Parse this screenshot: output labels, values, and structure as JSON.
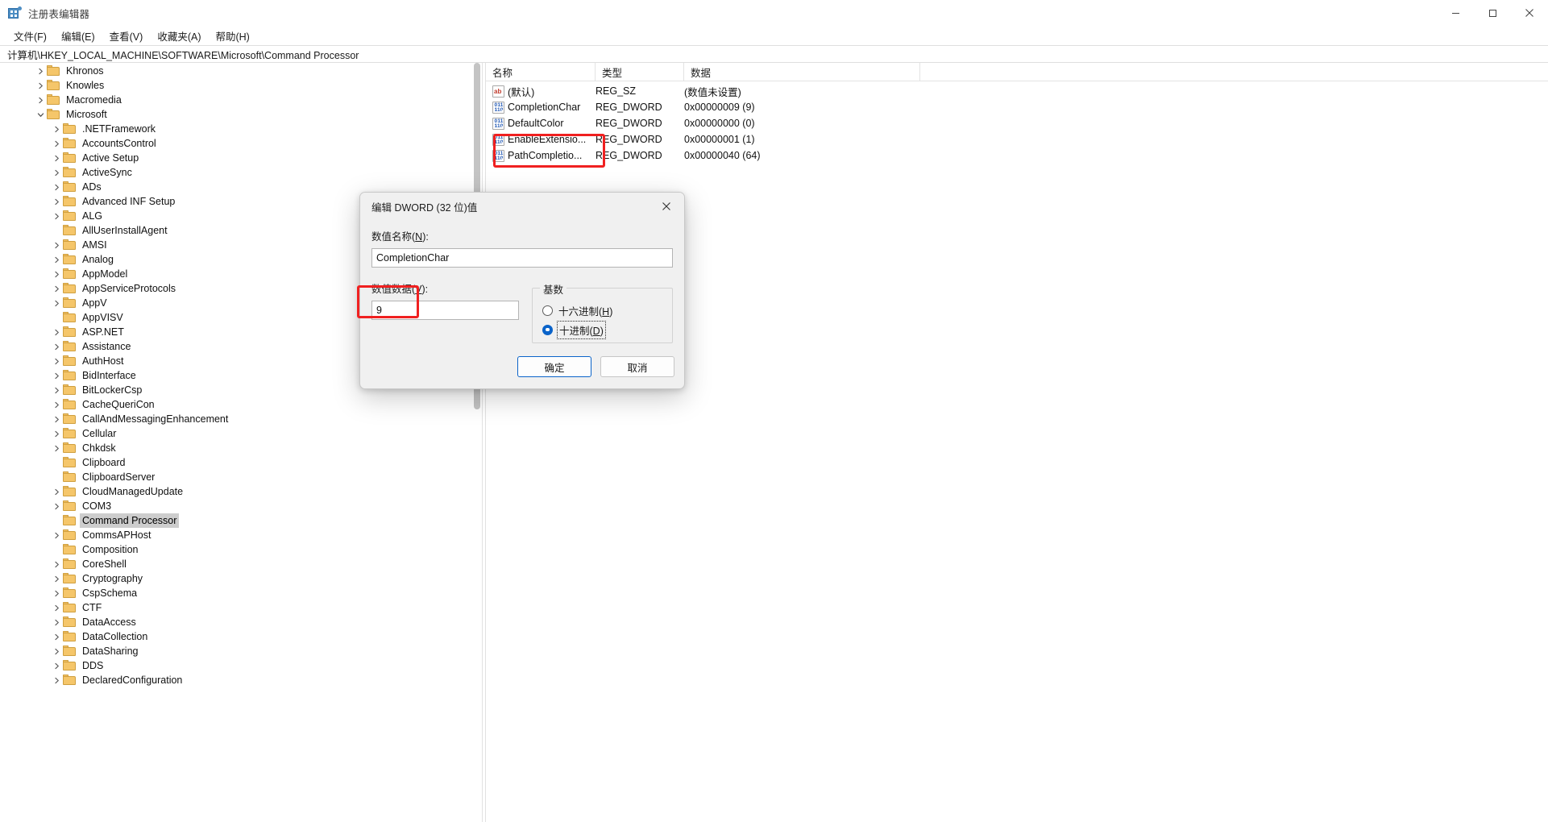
{
  "window": {
    "title": "注册表编辑器",
    "icon": "registry-editor-icon",
    "minimize_label": "最小化",
    "maximize_label": "最大化",
    "close_label": "关闭"
  },
  "menubar": {
    "items": [
      {
        "label": "文件(F)",
        "name": "menu-file"
      },
      {
        "label": "编辑(E)",
        "name": "menu-edit"
      },
      {
        "label": "查看(V)",
        "name": "menu-view"
      },
      {
        "label": "收藏夹(A)",
        "name": "menu-favorites"
      },
      {
        "label": "帮助(H)",
        "name": "menu-help"
      }
    ]
  },
  "address": {
    "path": "计算机\\HKEY_LOCAL_MACHINE\\SOFTWARE\\Microsoft\\Command Processor"
  },
  "tree": {
    "nodes": [
      {
        "label": "Khronos",
        "indent": 1,
        "expandable": true,
        "selected": false
      },
      {
        "label": "Knowles",
        "indent": 1,
        "expandable": true,
        "selected": false
      },
      {
        "label": "Macromedia",
        "indent": 1,
        "expandable": true,
        "selected": false
      },
      {
        "label": "Microsoft",
        "indent": 1,
        "expandable": true,
        "expanded": true,
        "selected": false
      },
      {
        "label": ".NETFramework",
        "indent": 2,
        "expandable": true,
        "selected": false
      },
      {
        "label": "AccountsControl",
        "indent": 2,
        "expandable": true,
        "selected": false
      },
      {
        "label": "Active Setup",
        "indent": 2,
        "expandable": true,
        "selected": false
      },
      {
        "label": "ActiveSync",
        "indent": 2,
        "expandable": true,
        "selected": false
      },
      {
        "label": "ADs",
        "indent": 2,
        "expandable": true,
        "selected": false
      },
      {
        "label": "Advanced INF Setup",
        "indent": 2,
        "expandable": true,
        "selected": false
      },
      {
        "label": "ALG",
        "indent": 2,
        "expandable": true,
        "selected": false
      },
      {
        "label": "AllUserInstallAgent",
        "indent": 2,
        "expandable": false,
        "selected": false
      },
      {
        "label": "AMSI",
        "indent": 2,
        "expandable": true,
        "selected": false
      },
      {
        "label": "Analog",
        "indent": 2,
        "expandable": true,
        "selected": false
      },
      {
        "label": "AppModel",
        "indent": 2,
        "expandable": true,
        "selected": false
      },
      {
        "label": "AppServiceProtocols",
        "indent": 2,
        "expandable": true,
        "selected": false
      },
      {
        "label": "AppV",
        "indent": 2,
        "expandable": true,
        "selected": false
      },
      {
        "label": "AppVISV",
        "indent": 2,
        "expandable": false,
        "selected": false
      },
      {
        "label": "ASP.NET",
        "indent": 2,
        "expandable": true,
        "selected": false
      },
      {
        "label": "Assistance",
        "indent": 2,
        "expandable": true,
        "selected": false
      },
      {
        "label": "AuthHost",
        "indent": 2,
        "expandable": true,
        "selected": false
      },
      {
        "label": "BidInterface",
        "indent": 2,
        "expandable": true,
        "selected": false
      },
      {
        "label": "BitLockerCsp",
        "indent": 2,
        "expandable": true,
        "selected": false
      },
      {
        "label": "CacheQueriCon",
        "indent": 2,
        "expandable": true,
        "selected": false
      },
      {
        "label": "CallAndMessagingEnhancement",
        "indent": 2,
        "expandable": true,
        "selected": false
      },
      {
        "label": "Cellular",
        "indent": 2,
        "expandable": true,
        "selected": false
      },
      {
        "label": "Chkdsk",
        "indent": 2,
        "expandable": true,
        "selected": false
      },
      {
        "label": "Clipboard",
        "indent": 2,
        "expandable": false,
        "selected": false
      },
      {
        "label": "ClipboardServer",
        "indent": 2,
        "expandable": false,
        "selected": false
      },
      {
        "label": "CloudManagedUpdate",
        "indent": 2,
        "expandable": true,
        "selected": false
      },
      {
        "label": "COM3",
        "indent": 2,
        "expandable": true,
        "selected": false
      },
      {
        "label": "Command Processor",
        "indent": 2,
        "expandable": false,
        "selected": true
      },
      {
        "label": "CommsAPHost",
        "indent": 2,
        "expandable": true,
        "selected": false
      },
      {
        "label": "Composition",
        "indent": 2,
        "expandable": false,
        "selected": false
      },
      {
        "label": "CoreShell",
        "indent": 2,
        "expandable": true,
        "selected": false
      },
      {
        "label": "Cryptography",
        "indent": 2,
        "expandable": true,
        "selected": false
      },
      {
        "label": "CspSchema",
        "indent": 2,
        "expandable": true,
        "selected": false
      },
      {
        "label": "CTF",
        "indent": 2,
        "expandable": true,
        "selected": false
      },
      {
        "label": "DataAccess",
        "indent": 2,
        "expandable": true,
        "selected": false
      },
      {
        "label": "DataCollection",
        "indent": 2,
        "expandable": true,
        "selected": false
      },
      {
        "label": "DataSharing",
        "indent": 2,
        "expandable": true,
        "selected": false
      },
      {
        "label": "DDS",
        "indent": 2,
        "expandable": true,
        "selected": false
      },
      {
        "label": "DeclaredConfiguration",
        "indent": 2,
        "expandable": true,
        "selected": false
      }
    ]
  },
  "listview": {
    "columns": [
      {
        "label": "名称",
        "name": "column-name"
      },
      {
        "label": "类型",
        "name": "column-type"
      },
      {
        "label": "数据",
        "name": "column-data"
      }
    ],
    "rows": [
      {
        "name": "(默认)",
        "type": "REG_SZ",
        "data": "(数值未设置)",
        "icon": "string-value-icon",
        "icon_kind": "sz"
      },
      {
        "name": "CompletionChar",
        "type": "REG_DWORD",
        "data": "0x00000009 (9)",
        "icon": "dword-value-icon",
        "icon_kind": "dw"
      },
      {
        "name": "DefaultColor",
        "type": "REG_DWORD",
        "data": "0x00000000 (0)",
        "icon": "dword-value-icon",
        "icon_kind": "dw"
      },
      {
        "name": "EnableExtensio...",
        "type": "REG_DWORD",
        "data": "0x00000001 (1)",
        "icon": "dword-value-icon",
        "icon_kind": "dw"
      },
      {
        "name": "PathCompletio...",
        "type": "REG_DWORD",
        "data": "0x00000040 (64)",
        "icon": "dword-value-icon",
        "icon_kind": "dw"
      }
    ]
  },
  "dialog": {
    "title": "编辑 DWORD (32 位)值",
    "close_label": "关闭",
    "name_label_pre": "数值名称(",
    "name_label_key": "N",
    "name_label_post": "):",
    "name_value": "CompletionChar",
    "data_label_pre": "数值数据(",
    "data_label_key": "V",
    "data_label_post": "):",
    "data_value": "9",
    "base_group_title": "基数",
    "base_options": [
      {
        "label_pre": "十六进制(",
        "key": "H",
        "label_post": ")",
        "selected": false,
        "focused": false,
        "name": "radio-hexadecimal"
      },
      {
        "label_pre": "十进制(",
        "key": "D",
        "label_post": ")",
        "selected": true,
        "focused": true,
        "name": "radio-decimal"
      }
    ],
    "ok_label": "确定",
    "cancel_label": "取消"
  },
  "annotations": {
    "highlight_color": "#f02020",
    "boxes": [
      {
        "name": "annotation-completionchar-row",
        "target": "CompletionChar"
      },
      {
        "name": "annotation-value-data-field",
        "target": "9"
      }
    ]
  }
}
